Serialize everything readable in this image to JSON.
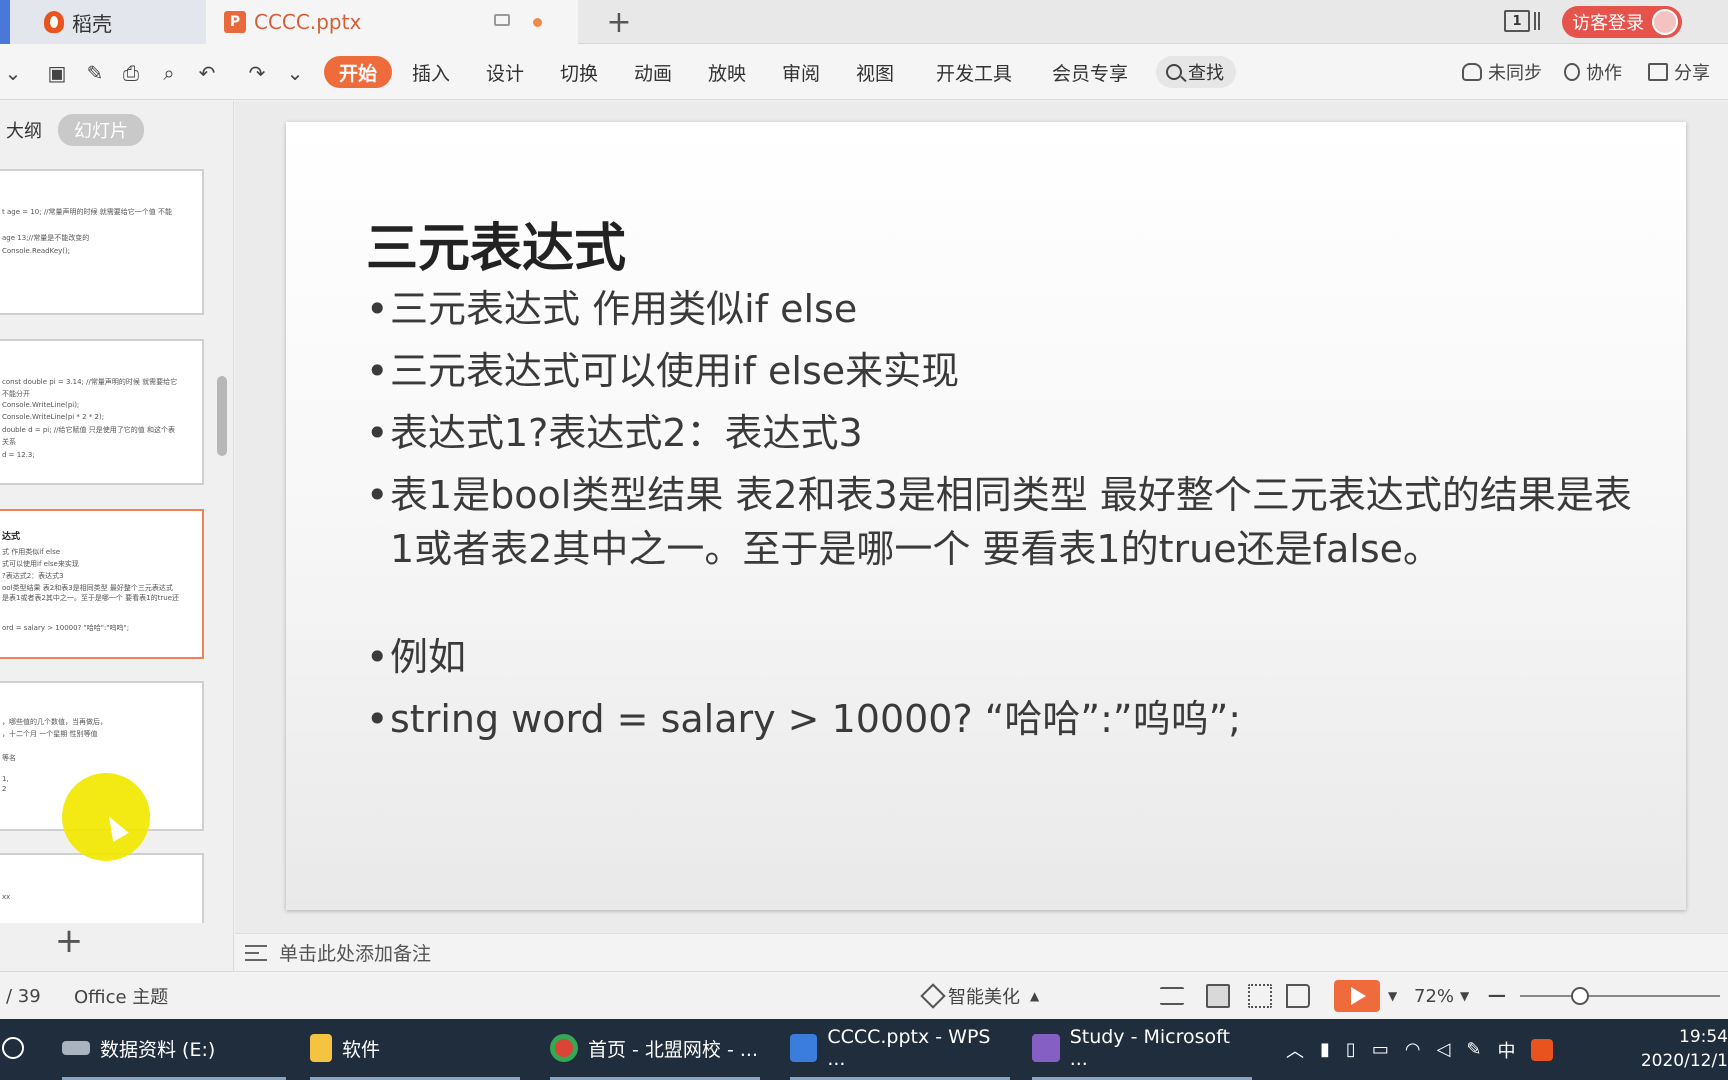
{
  "titlebar": {
    "tabs": [
      {
        "label": "稻壳"
      },
      {
        "label": "CCCC.pptx"
      }
    ],
    "window_count": "1",
    "login_label": "访客登录"
  },
  "ribbon": {
    "menu": [
      "开始",
      "插入",
      "设计",
      "切换",
      "动画",
      "放映",
      "审阅",
      "视图",
      "开发工具",
      "会员专享"
    ],
    "search_label": "查找",
    "right": [
      "未同步",
      "协作",
      "分享"
    ]
  },
  "left_panel": {
    "view_tabs": [
      "大纲",
      "幻灯片"
    ],
    "thumbs": [
      {
        "lines": [
          "t age = 10; //常量声明的时候 就需要给它一个值 不能",
          "age    13;//常量是不能改变的",
          "Console.ReadKey();"
        ]
      },
      {
        "lines": [
          "const double pi = 3.14; //常量声明的时候 就需要给它",
          "不能分开",
          "Console.WriteLine(pi);",
          "Console.WriteLine(pi * 2 * 2);",
          "double d = pi; //给它赋值 只是使用了它的值 和这个表",
          "关系",
          "d = 12.3;"
        ]
      },
      {
        "title": "达式",
        "lines": [
          "式 作用类似if else",
          "式可以使用if else来实现",
          "?表达式2：表达式3",
          "ool类型结果 表2和表3是相同类型 最好整个三元表达式",
          "是表1或者表2其中之一。至于是哪一个 要看表1的true还",
          "",
          "ord = salary > 10000? \"哈哈\":\"呜呜\";"
        ]
      },
      {
        "lines": [
          "，哪些值的几个数值，当再做后，",
          "，十二个月 一个星期 性别等值",
          "",
          "等名",
          "",
          "1,",
          "2"
        ]
      },
      {
        "lines": [
          "",
          "xx"
        ]
      }
    ]
  },
  "slide": {
    "title": "三元表达式",
    "bullets": [
      "三元表达式 作用类似if else",
      "三元表达式可以使用if else来实现",
      "表达式1?表达式2：表达式3",
      "表1是bool类型结果 表2和表3是相同类型 最好整个三元表达式的结果是表1或者表2其中之一。至于是哪一个 要看表1的true还是false。",
      "例如",
      "string word = salary > 10000? “哈哈”:”呜呜”;"
    ]
  },
  "notes_placeholder": "单击此处添加备注",
  "status": {
    "page": "/ 39",
    "theme": "Office 主题",
    "beautify": "智能美化",
    "zoom": "72%",
    "zoom_level": 0.3
  },
  "taskbar": {
    "items": [
      "数据资料 (E:)",
      "软件",
      "首页 - 北盟网校 - ...",
      "CCCC.pptx - WPS ...",
      "Study - Microsoft ..."
    ],
    "ime": "中",
    "time": "19:54",
    "date": "2020/12/1"
  },
  "colors": {
    "accent": "#ee6c3b",
    "login": "#e5534b",
    "taskbar": "#1f2d3d"
  }
}
